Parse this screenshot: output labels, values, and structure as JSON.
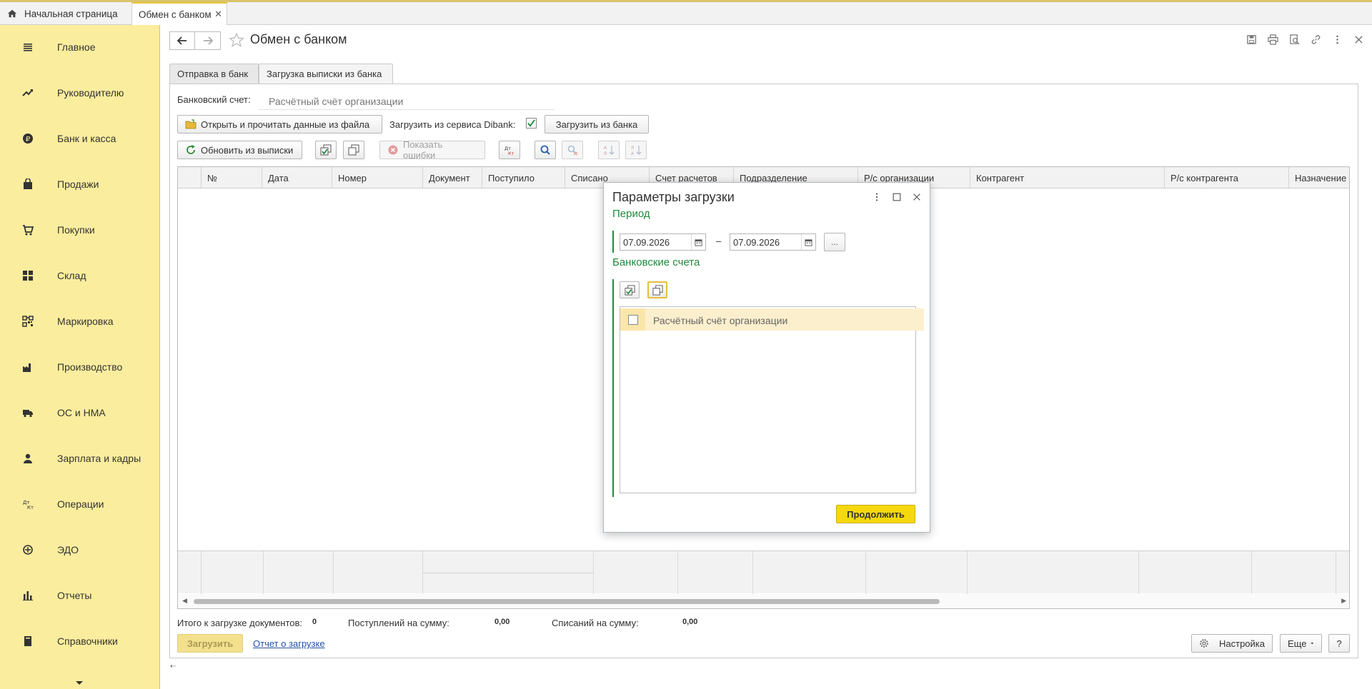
{
  "top_tabs": {
    "home_label": "Начальная страница",
    "active_label": "Обмен с банком"
  },
  "sidebar": {
    "items": [
      {
        "label": "Главное",
        "icon": "menu-icon"
      },
      {
        "label": "Руководителю",
        "icon": "trend-icon"
      },
      {
        "label": "Банк и касса",
        "icon": "ruble-icon"
      },
      {
        "label": "Продажи",
        "icon": "bag-icon"
      },
      {
        "label": "Покупки",
        "icon": "cart-icon"
      },
      {
        "label": "Склад",
        "icon": "grid-icon"
      },
      {
        "label": "Маркировка",
        "icon": "qr-icon"
      },
      {
        "label": "Производство",
        "icon": "factory-icon"
      },
      {
        "label": "ОС и НМА",
        "icon": "truck-icon"
      },
      {
        "label": "Зарплата и кадры",
        "icon": "person-icon"
      },
      {
        "label": "Операции",
        "icon": "dtkt-icon"
      },
      {
        "label": "ЭДО",
        "icon": "edo-icon"
      },
      {
        "label": "Отчеты",
        "icon": "bar-chart-icon"
      },
      {
        "label": "Справочники",
        "icon": "book-icon"
      }
    ]
  },
  "header": {
    "title": "Обмен с банком"
  },
  "form_tabs": [
    "Отправка в банк",
    "Загрузка выписки из банка"
  ],
  "form": {
    "bank_account_label": "Банковский счет:",
    "bank_account_placeholder": "Расчётный счёт организации",
    "open_file_button": "Открыть и прочитать данные из файла",
    "dibank_label": "Загрузить из сервиса Dibank:",
    "load_from_bank_button": "Загрузить из банка",
    "refresh_button": "Обновить из выписки",
    "show_errors_button": "Показать ошибки"
  },
  "grid": {
    "columns": [
      "№",
      "Дата",
      "Номер",
      "Документ",
      "Поступило",
      "Списано",
      "Счет расчетов",
      "Подразделение",
      "Р/с организации",
      "Контрагент",
      "Р/с контрагента",
      "Назначение п"
    ]
  },
  "totals": {
    "docs_label": "Итого к загрузке документов:",
    "docs_value": "0",
    "income_label": "Поступлений на сумму:",
    "income_value": "0,00",
    "outcome_label": "Списаний на сумму:",
    "outcome_value": "0,00"
  },
  "bottom": {
    "load_button": "Загрузить",
    "report_link": "Отчет о загрузке",
    "settings_button": "Настройка",
    "more_button": "Еще",
    "help_button": "?"
  },
  "modal": {
    "title": "Параметры загрузки",
    "period_label": "Период",
    "date_from": "07.09.2026",
    "date_to": "07.09.2026",
    "dash": "–",
    "dots_button": "...",
    "accounts_label": "Банковские счета",
    "account_row": "Расчётный счёт организации",
    "continue_button": "Продолжить"
  }
}
